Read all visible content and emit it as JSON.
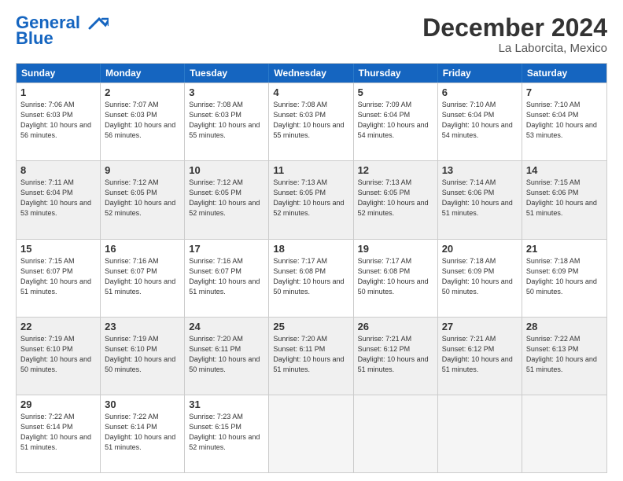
{
  "logo": {
    "line1": "General",
    "line2": "Blue"
  },
  "title": "December 2024",
  "subtitle": "La Laborcita, Mexico",
  "days": [
    "Sunday",
    "Monday",
    "Tuesday",
    "Wednesday",
    "Thursday",
    "Friday",
    "Saturday"
  ],
  "weeks": [
    [
      {
        "day": "1",
        "rise": "7:06 AM",
        "set": "6:03 PM",
        "daylight": "10 hours and 56 minutes."
      },
      {
        "day": "2",
        "rise": "7:07 AM",
        "set": "6:03 PM",
        "daylight": "10 hours and 56 minutes."
      },
      {
        "day": "3",
        "rise": "7:08 AM",
        "set": "6:03 PM",
        "daylight": "10 hours and 55 minutes."
      },
      {
        "day": "4",
        "rise": "7:08 AM",
        "set": "6:03 PM",
        "daylight": "10 hours and 55 minutes."
      },
      {
        "day": "5",
        "rise": "7:09 AM",
        "set": "6:04 PM",
        "daylight": "10 hours and 54 minutes."
      },
      {
        "day": "6",
        "rise": "7:10 AM",
        "set": "6:04 PM",
        "daylight": "10 hours and 54 minutes."
      },
      {
        "day": "7",
        "rise": "7:10 AM",
        "set": "6:04 PM",
        "daylight": "10 hours and 53 minutes."
      }
    ],
    [
      {
        "day": "8",
        "rise": "7:11 AM",
        "set": "6:04 PM",
        "daylight": "10 hours and 53 minutes."
      },
      {
        "day": "9",
        "rise": "7:12 AM",
        "set": "6:05 PM",
        "daylight": "10 hours and 52 minutes."
      },
      {
        "day": "10",
        "rise": "7:12 AM",
        "set": "6:05 PM",
        "daylight": "10 hours and 52 minutes."
      },
      {
        "day": "11",
        "rise": "7:13 AM",
        "set": "6:05 PM",
        "daylight": "10 hours and 52 minutes."
      },
      {
        "day": "12",
        "rise": "7:13 AM",
        "set": "6:05 PM",
        "daylight": "10 hours and 52 minutes."
      },
      {
        "day": "13",
        "rise": "7:14 AM",
        "set": "6:06 PM",
        "daylight": "10 hours and 51 minutes."
      },
      {
        "day": "14",
        "rise": "7:15 AM",
        "set": "6:06 PM",
        "daylight": "10 hours and 51 minutes."
      }
    ],
    [
      {
        "day": "15",
        "rise": "7:15 AM",
        "set": "6:07 PM",
        "daylight": "10 hours and 51 minutes."
      },
      {
        "day": "16",
        "rise": "7:16 AM",
        "set": "6:07 PM",
        "daylight": "10 hours and 51 minutes."
      },
      {
        "day": "17",
        "rise": "7:16 AM",
        "set": "6:07 PM",
        "daylight": "10 hours and 51 minutes."
      },
      {
        "day": "18",
        "rise": "7:17 AM",
        "set": "6:08 PM",
        "daylight": "10 hours and 50 minutes."
      },
      {
        "day": "19",
        "rise": "7:17 AM",
        "set": "6:08 PM",
        "daylight": "10 hours and 50 minutes."
      },
      {
        "day": "20",
        "rise": "7:18 AM",
        "set": "6:09 PM",
        "daylight": "10 hours and 50 minutes."
      },
      {
        "day": "21",
        "rise": "7:18 AM",
        "set": "6:09 PM",
        "daylight": "10 hours and 50 minutes."
      }
    ],
    [
      {
        "day": "22",
        "rise": "7:19 AM",
        "set": "6:10 PM",
        "daylight": "10 hours and 50 minutes."
      },
      {
        "day": "23",
        "rise": "7:19 AM",
        "set": "6:10 PM",
        "daylight": "10 hours and 50 minutes."
      },
      {
        "day": "24",
        "rise": "7:20 AM",
        "set": "6:11 PM",
        "daylight": "10 hours and 50 minutes."
      },
      {
        "day": "25",
        "rise": "7:20 AM",
        "set": "6:11 PM",
        "daylight": "10 hours and 51 minutes."
      },
      {
        "day": "26",
        "rise": "7:21 AM",
        "set": "6:12 PM",
        "daylight": "10 hours and 51 minutes."
      },
      {
        "day": "27",
        "rise": "7:21 AM",
        "set": "6:12 PM",
        "daylight": "10 hours and 51 minutes."
      },
      {
        "day": "28",
        "rise": "7:22 AM",
        "set": "6:13 PM",
        "daylight": "10 hours and 51 minutes."
      }
    ],
    [
      {
        "day": "29",
        "rise": "7:22 AM",
        "set": "6:14 PM",
        "daylight": "10 hours and 51 minutes."
      },
      {
        "day": "30",
        "rise": "7:22 AM",
        "set": "6:14 PM",
        "daylight": "10 hours and 51 minutes."
      },
      {
        "day": "31",
        "rise": "7:23 AM",
        "set": "6:15 PM",
        "daylight": "10 hours and 52 minutes."
      },
      null,
      null,
      null,
      null
    ]
  ]
}
